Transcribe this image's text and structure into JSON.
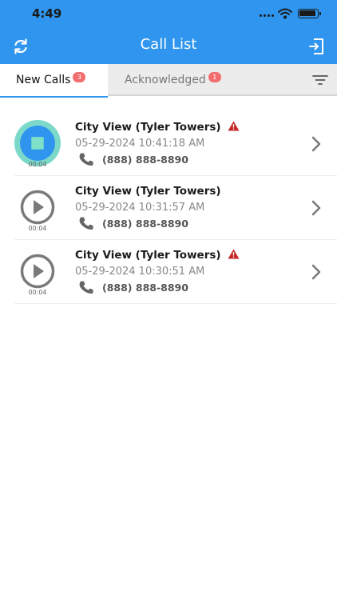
{
  "status_bar": {
    "time": "4:49"
  },
  "header": {
    "title": "Call List"
  },
  "tabs": [
    {
      "label": "New Calls",
      "badge": "3"
    },
    {
      "label": "Acknowledged",
      "badge": "1"
    }
  ],
  "calls": [
    {
      "title": "City View (Tyler Towers)",
      "datetime": "05-29-2024 10:41:18 AM",
      "phone": "(888) 888-8890",
      "duration": "00:04",
      "warning": true,
      "playing": true
    },
    {
      "title": "City View (Tyler Towers)",
      "datetime": "05-29-2024 10:31:57 AM",
      "phone": "(888) 888-8890",
      "duration": "00:04",
      "warning": false,
      "playing": false
    },
    {
      "title": "City View (Tyler Towers)",
      "datetime": "05-29-2024 10:30:51 AM",
      "phone": "(888) 888-8890",
      "duration": "00:04",
      "warning": true,
      "playing": false
    }
  ],
  "colors": {
    "primary": "#2f95ee",
    "badge": "#f26d6d",
    "warning": "#c62828",
    "playing_ring": "#6ed5c3",
    "stop_square": "#7fe0c9"
  },
  "icons": [
    "refresh-icon",
    "logout-icon",
    "filter-icon",
    "stop-icon",
    "play-icon",
    "warning-icon",
    "phone-icon",
    "chevron-right-icon"
  ]
}
